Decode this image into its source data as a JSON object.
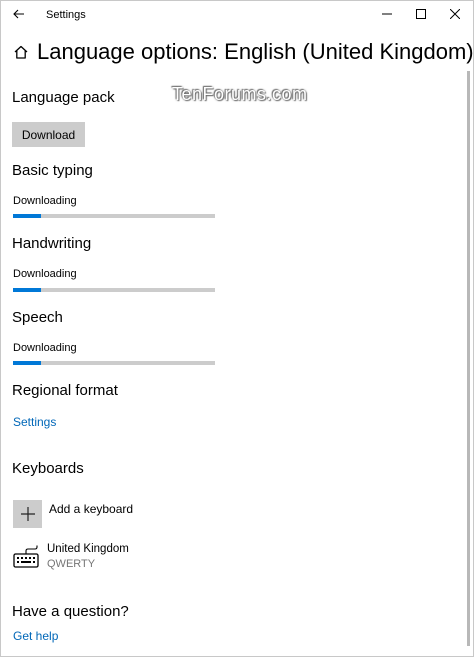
{
  "window": {
    "app_title": "Settings",
    "controls": {
      "minimize": "minimize-icon",
      "maximize": "maximize-icon",
      "close": "close-icon"
    }
  },
  "watermark": "TenForums.com",
  "header": {
    "title": "Language options: English (United Kingdom)",
    "icon": "home-icon"
  },
  "language_pack": {
    "heading": "Language pack",
    "button_label": "Download"
  },
  "basic_typing": {
    "heading": "Basic typing",
    "status": "Downloading",
    "progress": 0.14
  },
  "handwriting": {
    "heading": "Handwriting",
    "status": "Downloading",
    "progress": 0.14
  },
  "speech": {
    "heading": "Speech",
    "status": "Downloading",
    "progress": 0.14
  },
  "regional_format": {
    "heading": "Regional format",
    "link": "Settings"
  },
  "keyboards": {
    "heading": "Keyboards",
    "add_label": "Add a keyboard",
    "items": [
      {
        "name": "United Kingdom",
        "layout": "QWERTY",
        "icon": "keyboard-icon"
      }
    ]
  },
  "help": {
    "heading": "Have a question?",
    "link": "Get help"
  },
  "colors": {
    "accent": "#0078d7",
    "link": "#0067b8",
    "button_bg": "#cccccc"
  }
}
